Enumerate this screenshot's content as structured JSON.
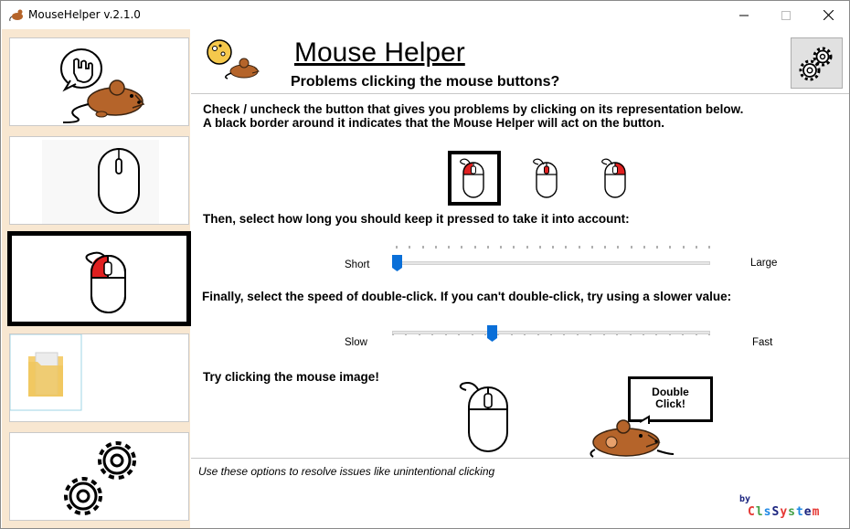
{
  "window": {
    "title": "MouseHelper v.2.1.0",
    "controls": [
      "minimize",
      "maximize",
      "close"
    ]
  },
  "sidebar": {
    "items": [
      {
        "name": "hand-mouse-mascot",
        "icon": "hand-click-mouse-icon"
      },
      {
        "name": "scroll-wheel",
        "icon": "mouse-wheel-icon"
      },
      {
        "name": "button-clicks",
        "icon": "mouse-left-click-icon",
        "active": true
      },
      {
        "name": "folder",
        "icon": "folder-icon"
      },
      {
        "name": "settings",
        "icon": "gears-icon"
      }
    ]
  },
  "header": {
    "title": "Mouse Helper",
    "subtitle": "Problems clicking the mouse buttons?",
    "settings_icon": "gears-icon"
  },
  "main": {
    "instruction_line1": "Check / uncheck the button that gives you problems by clicking on its representation below.",
    "instruction_line2": "A black border around it indicates that the Mouse Helper will act on the button.",
    "buttons": [
      {
        "name": "left-button",
        "selected": true
      },
      {
        "name": "middle-button",
        "selected": false
      },
      {
        "name": "right-button",
        "selected": false
      }
    ],
    "press_duration_text": "Then, select how long you should keep it pressed to take it into account:",
    "press_slider": {
      "min_label": "Short",
      "max_label": "Large",
      "value": 0
    },
    "double_click_text": "Finally, select the speed of double-click. If you can't double-click, try using a slower value:",
    "double_click_slider": {
      "min_label": "Slow",
      "max_label": "Fast",
      "value": 0.31
    },
    "try_text": "Try clicking the mouse image!",
    "bubble_line1": "Double",
    "bubble_line2": "Click!"
  },
  "footer": {
    "description": "Use these options to resolve issues like unintentional clicking",
    "by": "by",
    "brand": "ClsSystem"
  },
  "colors": {
    "sidebar_bg": "#f8e7d1",
    "accent_red": "#e02020",
    "slider_thumb": "#0a6fd8",
    "mouse_body": "#b5642a",
    "brand_colors": [
      "#1a237e",
      "#e53935",
      "#43a047",
      "#1e88e5"
    ]
  }
}
